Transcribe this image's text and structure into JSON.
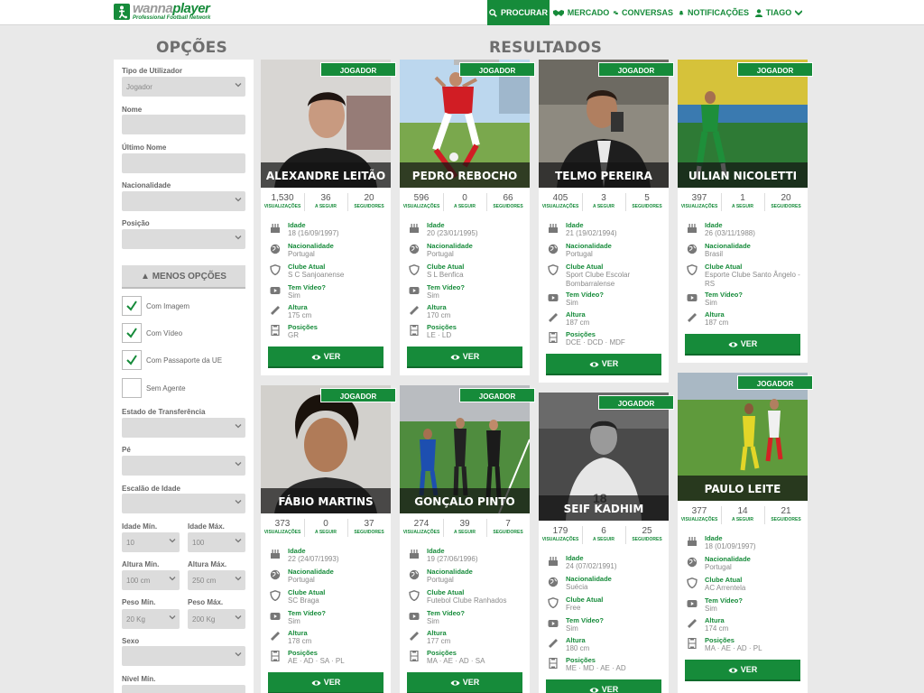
{
  "app": {
    "brand_part1": "wanna",
    "brand_part2": "player",
    "tagline": "Professional Football Network"
  },
  "nav": {
    "procurar": "PROCURAR",
    "mercado": "MERCADO",
    "conversas": "CONVERSAS",
    "notificacoes": "NOTIFICAÇÕES",
    "user": "TIAGO"
  },
  "headings": {
    "options": "OPÇÕES",
    "results": "RESULTADOS"
  },
  "filters": {
    "tipo_label": "Tipo de Utilizador",
    "tipo_value": "Jogador",
    "nome_label": "Nome",
    "ultimo_label": "Último Nome",
    "nacionalidade_label": "Nacionalidade",
    "posicao_label": "Posição",
    "less_options": "▲ MENOS OPÇÕES",
    "com_imagem": "Com Imagem",
    "com_video": "Com Vídeo",
    "com_passaporte": "Com Passaporte da UE",
    "sem_agente": "Sem Agente",
    "estado_label": "Estado de Transferência",
    "pe_label": "Pé",
    "escalao_label": "Escalão de Idade",
    "idade_min_label": "Idade Mín.",
    "idade_min_value": "10",
    "idade_max_label": "Idade Máx.",
    "idade_max_value": "100",
    "altura_min_label": "Altura Mín.",
    "altura_min_value": "100 cm",
    "altura_max_label": "Altura Máx.",
    "altura_max_value": "250 cm",
    "peso_min_label": "Peso Mín.",
    "peso_min_value": "20 Kg",
    "peso_max_label": "Peso Máx.",
    "peso_max_value": "200 Kg",
    "sexo_label": "Sexo",
    "nivel_label": "Nível Mín."
  },
  "card_labels": {
    "badge": "JOGADOR",
    "views": "VISUALIZAÇÕES",
    "following": "A SEGUIR",
    "followers": "SEGUIDORES",
    "age": "Idade",
    "nationality": "Nacionalidade",
    "club": "Clube Atual",
    "video": "Tem Vídeo?",
    "height": "Altura",
    "positions": "Posições",
    "view_btn": "VER"
  },
  "colors": {
    "accent": "#168b3a",
    "background": "#e9e9e9"
  },
  "players": [
    {
      "name": "ALEXANDRE LEITÃO",
      "views": "1,530",
      "following": "36",
      "followers": "20",
      "age": "18 (16/09/1997)",
      "nationality": "Portugal",
      "club": "S C Sanjoanense",
      "video": "Sim",
      "height": "175 cm",
      "positions": "GR"
    },
    {
      "name": "PEDRO REBOCHO",
      "views": "596",
      "following": "0",
      "followers": "66",
      "age": "20 (23/01/1995)",
      "nationality": "Portugal",
      "club": "S L Benfica",
      "video": "Sim",
      "height": "170 cm",
      "positions": "LE · LD"
    },
    {
      "name": "TELMO PEREIRA",
      "views": "405",
      "following": "3",
      "followers": "5",
      "age": "21 (19/02/1994)",
      "nationality": "Portugal",
      "club": "Sport Clube Escolar Bombarralense",
      "video": "Sim",
      "height": "187 cm",
      "positions": "DCE · DCD · MDF"
    },
    {
      "name": "UILIAN NICOLETTI",
      "views": "397",
      "following": "1",
      "followers": "20",
      "age": "26 (03/11/1988)",
      "nationality": "Brasil",
      "club": "Esporte Clube Santo Ângelo -RS",
      "video": "Sim",
      "height": "187 cm",
      "positions": ""
    },
    {
      "name": "FÁBIO MARTINS",
      "views": "373",
      "following": "0",
      "followers": "37",
      "age": "22 (24/07/1993)",
      "nationality": "Portugal",
      "club": "SC Braga",
      "video": "Sim",
      "height": "178 cm",
      "positions": "AE · AD · SA · PL"
    },
    {
      "name": "GONÇALO PINTO",
      "views": "274",
      "following": "39",
      "followers": "7",
      "age": "19 (27/06/1996)",
      "nationality": "Portugal",
      "club": "Futebol Clube Ranhados",
      "video": "Sim",
      "height": "177 cm",
      "positions": "MA · AE · AD · SA"
    },
    {
      "name": "SEIF KADHIM",
      "views": "179",
      "following": "6",
      "followers": "25",
      "age": "24 (07/02/1991)",
      "nationality": "Suécia",
      "club": "Free",
      "video": "Sim",
      "height": "180 cm",
      "positions": "ME · MD · AE · AD"
    },
    {
      "name": "PAULO LEITE",
      "views": "377",
      "following": "14",
      "followers": "21",
      "age": "18 (01/09/1997)",
      "nationality": "Portugal",
      "club": "AC Arrentela",
      "video": "Sim",
      "height": "174 cm",
      "positions": "MA · AE · AD · PL"
    }
  ]
}
